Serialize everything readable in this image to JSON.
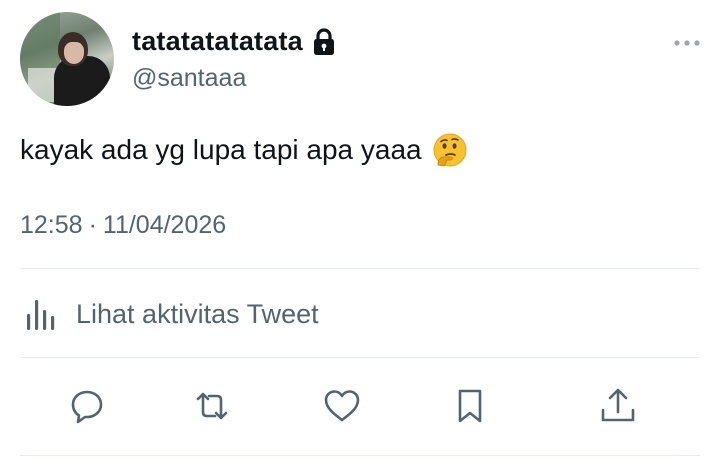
{
  "author": {
    "display_name": "tatatatatatata",
    "handle": "@santaaa"
  },
  "tweet": {
    "text": "kayak ada yg lupa tapi apa yaaa",
    "emoji": "thinking-face",
    "time": "12:58",
    "separator": "·",
    "date": "11/04/2026"
  },
  "activity": {
    "label": "Lihat aktivitas Tweet"
  },
  "icons": {
    "lock": "lock-icon",
    "more": "more-icon",
    "activity": "bar-chart-icon",
    "reply": "reply-icon",
    "retweet": "retweet-icon",
    "like": "heart-icon",
    "bookmark": "bookmark-icon",
    "share": "share-icon"
  },
  "colors": {
    "text_primary": "#0f1419",
    "text_secondary": "#536471",
    "divider": "#e6ecf0"
  }
}
